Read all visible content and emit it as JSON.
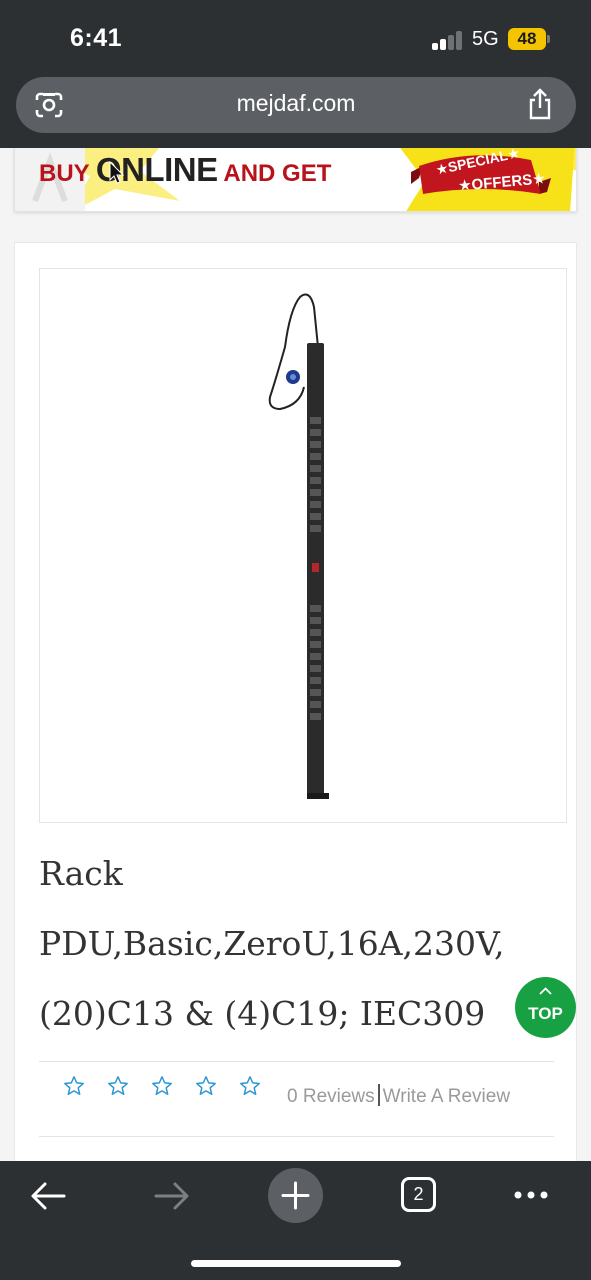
{
  "status": {
    "time": "6:41",
    "network": "5G",
    "battery": "48"
  },
  "browser": {
    "url": "mejdaf.com",
    "tab_count": "2"
  },
  "banner": {
    "part1": "BUY ",
    "part2": "ONLINE",
    "part3": " AND GET",
    "ribbon_line1": "★SPECIAL★",
    "ribbon_line2": "★OFFERS★"
  },
  "product": {
    "title": "Rack PDU,Basic,ZeroU,16A,230V, (20)C13 & (4)C19; IEC309",
    "rating": 0,
    "max_rating": 5,
    "reviews": "0 Reviews",
    "write_review": "Write A Review"
  },
  "top_button": "TOP",
  "colors": {
    "bar": "#2d3033",
    "accent_green": "#17a143",
    "star_blue": "#2a95d6",
    "banner_red": "#b8131b",
    "banner_yellow": "#f7e21a"
  }
}
